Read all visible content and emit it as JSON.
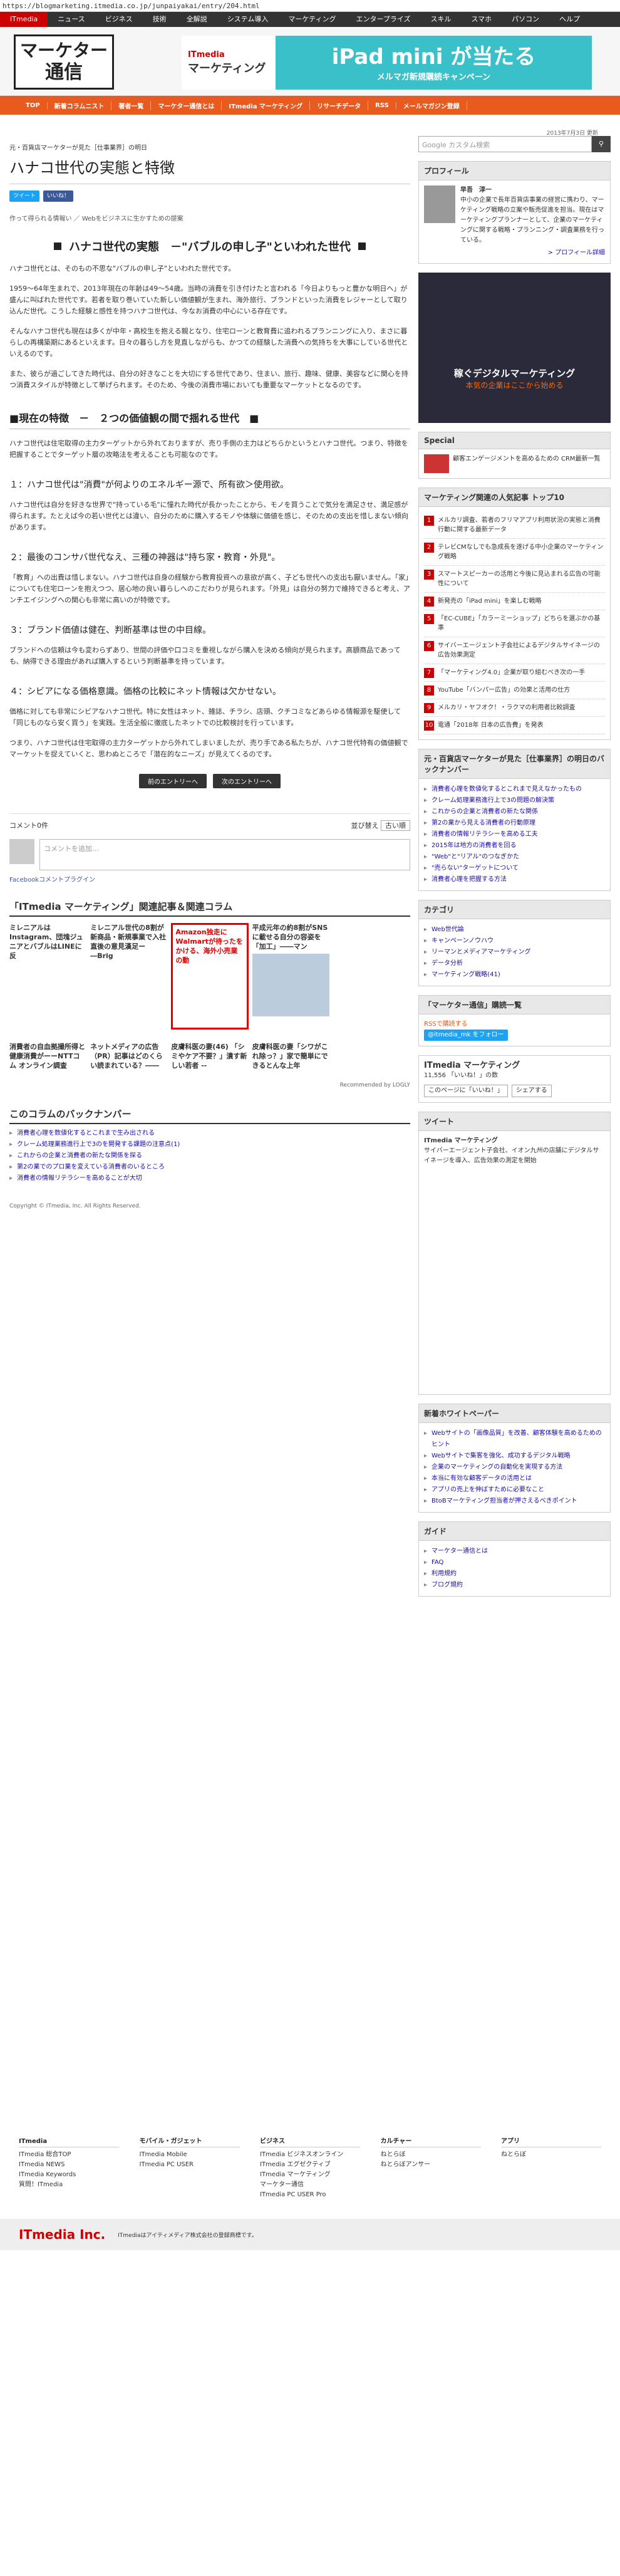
{
  "url": "https://blogmarketing.itmedia.co.jp/junpaiyakai/entry/204.html",
  "global_nav": [
    "ITmedia",
    "ニュース",
    "ビジネス",
    "技術",
    "全解説",
    "システム導入",
    "マーケティング",
    "エンタープライズ",
    "スキル",
    "スマホ",
    "パソコン",
    "ヘルプ"
  ],
  "logo": {
    "line1": "マーケター",
    "line2": "通信"
  },
  "banner": {
    "brand1": "ITmedia",
    "brand2": "マーケティング",
    "headline": "iPad mini が当たる",
    "sub": "メルマガ新規購読キャンペーン"
  },
  "red_nav": [
    "TOP",
    "新着コラムニスト",
    "著者一覧",
    "マーケター通信とは",
    "ITmedia マーケティング",
    "リサーチデータ",
    "RSS",
    "メールマガジン登録"
  ],
  "article": {
    "breadcrumb": "元・百貨店マーケターが見た［仕事業界］の明日",
    "date": "2013年7月3日 更新",
    "title": "ハナコ世代の実態と特徴",
    "tweet": "ツイート",
    "like": "いいね！",
    "related_line": "作って得られる情報い ／ Webをビジネスに生かすための提案",
    "section1": "ハナコ世代の実態　－\"バブルの申し子\"といわれた世代",
    "p1": "ハナコ世代とは、そのもの不思な\"バブルの申し子\"といわれた世代です。",
    "p2": "1959〜64年生まれで、2013年現在の年齢は49〜54歳。当時の消費を引き付けたと言われる「今日よりもっと豊かな明日へ」が盛んに叫ばれた世代です。若者を取り巻いていた新しい価値観が生まれ、海外旅行、ブランドといった消費をレジャーとして取り込んだ世代。こうした経験と感性を持つハナコ世代は、今なお消費の中心にいる存在です。",
    "p3": "そんなハナコ世代も現在は多くが中年・高校生を抱える親となり、住宅ローンと教育費に追われるプランニングに入り、まさに暮らしの再構築期にあるといえます。日々の暮らし方を見直しながらも、かつての経験した消費への気持ちを大事にしている世代といえるのです。",
    "p4": "また、彼らが過ごしてきた時代は、自分の好きなことを大切にする世代であり、住まい、旅行、趣味、健康、美容などに関心を持つ消費スタイルが特徴として挙げられます。そのため、今後の消費市場においても重要なマーケットとなるのです。",
    "section2": "■現在の特徴　－　２つの価値観の間で揺れる世代　■",
    "p5": "ハナコ世代は住宅取得の主力ターゲットから外れておりますが、売り手側の主力はどちらかというとハナコ世代。つまり、特徴を把握することでターゲット層の攻略法を考えることも可能なのです。",
    "h3a": "１：ハナコ世代は\"消費\"が何よりのエネルギー源で、所有欲＞使用欲。",
    "p6": "ハナコ世代は自分を好きな世界で\"持っている毛\"に憧れた時代が長かったことから、モノを買うことで気分を満足させ、満足感が得られます。たとえば今の若い世代とは違い、自分のために購入するモノや体験に価値を感じ、そのための支出を惜しまない傾向があります。",
    "h3b": "２：最後のコンサバ世代なえ、三種の神器は\"持ち家・教育・外見\"。",
    "p7": "「教育」への出費は惜しまない。ハナコ世代は自身の経験から教育投資への意欲が高く、子ども世代への支出も厭いません。「家」についても住宅ローンを抱えつつ、居心地の良い暮らしへのこだわりが見られます。「外見」は自分の努力で維持できると考え、アンチエイジングへの関心も非常に高いのが特徴です。",
    "h3c": "３：ブランド価値は健在、判断基準は世の中目線。",
    "p8": "ブランドへの信頼は今も変わらずあり、世間の評価や口コミを重視しながら購入を決める傾向が見られます。高額商品であっても、納得できる理由があれば購入するという判断基準を持っています。",
    "h3d": "４：シビアになる価格意識。価格の比較にネット情報は欠かせない。",
    "p9": "価格に対しても非常にシビアなハナコ世代。特に女性はネット、雑誌、チラシ、店頭、クチコミなどあらゆる情報源を駆使して「同じものなら安く買う」を実践。生活全般に徹底したネットでの比較検討を行っています。",
    "p10": "つまり、ハナコ世代は住宅取得の主力ターゲットから外れてしまいましたが、売り手である私たちが、ハナコ世代特有の価値観でマーケットを捉えていくと、思わぬところで「潜在的なニーズ」が見えてくるのです。",
    "prev": "前のエントリーへ",
    "next": "次のエントリーへ"
  },
  "comments": {
    "count": "コメント0件",
    "sort": "並び替え",
    "sort_val": "古い順",
    "placeholder": "コメントを追加...",
    "fb": "Facebookコメントプラグイン"
  },
  "related": {
    "header": "「ITmedia マーケティング」関連記事＆関連コラム",
    "row1": [
      "ミレニアルはInstagram、団塊ジュニアとバブルはLINEに反",
      "ミレニアル世代の8割が新商品・新規事業で入社直後の意見漢足ー―Brig",
      "Amazon独走にWalmartが待ったをかける、海外小売業の動",
      "平成元年の約8割がSNSに載せる自分の容姿を「加工」――マン",
      ""
    ],
    "row2": [
      "消費者の自血拠撮所得と健康消費がーーNTTコム オンライン調査",
      "ネットメディアの広告（PR）記事はどのくらい読まれている？――",
      "皮膚科医の妻(46) 「シミやケア不要？」潰す新しい若者 --",
      "皮膚科医の妻「シワがこれ除っ？」家で簡単にできるとんな上年",
      ""
    ],
    "recommended": "Recommended by LOGLY"
  },
  "backnumber": {
    "header": "このコラムのバックナンバー",
    "items": [
      "消費者心理を数値化するとこれまで生み出される",
      "クレーム処理業務進行上で3のを開発する課題の注意点(1)",
      "これからの企業と消費者の新たな関係を探る",
      "第2の業でのプロ業を変えている消費者のいるところ",
      "消費者の情報リテラシーを高めることが大切"
    ]
  },
  "copyright": "Copyright © ITmedia, Inc. All Rights Reserved.",
  "sidebar": {
    "search_placeholder": "Google カスタム検索",
    "profile_title": "プロフィール",
    "profile_name": "早吾　淳一",
    "profile_text": "中小の企業で長年百貨店事業の経営に携わり、マーケティング戦略の立案や販売促進を担当。現在はマーケティングプランナーとして、企業のマーケティングに関する戦略・プランニング・調査業務を行っている。",
    "profile_link": "> プロフィール詳細",
    "ad_title1": "稼ぐデジタルマーケティング",
    "ad_title2": "本気の企業はここから始める",
    "special": "Special",
    "special_text": "顧客エンゲージメントを高めるための CRM最新一覧",
    "ranking_title": "マーケティング関連の人気記事 トップ10",
    "ranking": [
      "メルカリ調査、若者のフリマアプリ利用状況の実態と消費行動に関する最新データ",
      "テレビCMなしでも急成長を遂げる中小企業のマーケティング戦略",
      "スマートスピーカーの活用と今後に見込まれる広告の可能性について",
      "新発売の「iPad mini」を楽しむ戦略",
      "「EC-CUBE」「カラーミーショップ」どちらを選ぶかの基準",
      "サイバーエージェント子会社によるデジタルサイネージの広告効果測定",
      "「マーケティング4.0」企業が取り組むべき次の一手",
      "YouTube「バンパー広告」の効果と活用の仕方",
      "メルカリ・ヤフオク！・ラクマの利用者比較調査",
      "電通「2018年 日本の広告費」を発表"
    ],
    "column_title": "元・百貨店マーケターが見た［仕事業界］の明日のバックナンバー",
    "column_items": [
      "消費者心理を数値化するとこれまで見えなかったもの",
      "クレーム処理業務進行上で3の問題の解決策",
      "これからの企業と消費者の新たな関係",
      "第2の業から見える消費者の行動原理",
      "消費者の情報リテラシーを高める工夫",
      "2015年は地方の消費者を回る",
      "\"Web\"と\"リアル\"のつなぎかた",
      "\"売らない\"ターゲットについて",
      "消費者心理を把握する方法"
    ],
    "category_title": "カテゴリ",
    "categories": [
      "Web世代論",
      "キャンペーンノウハウ",
      "リーマンとメディアマーケティング",
      "データ分析",
      "マーケティング戦略(41)"
    ],
    "mk_title": "「マーケター通信」購読一覧",
    "rss": "RSSで購読する",
    "twitter": "@itmedia_mk をフォロー",
    "fb_name": "ITmedia マーケティング",
    "fb_likes": "11,556 「いいね！」の数",
    "fb_like": "このページに「いいね！」",
    "fb_share": "シェアする",
    "tweets_title": "ツイート",
    "tw_author": "ITmedia マーケティング",
    "tw_text": "サイバーエージェント子会社、イオン九州の店舗にデジタルサイネージを導入、広告効果の測定を開始",
    "news_title": "新着ホワイトペーパー",
    "news": [
      "Webサイトの「画像品質」を改善、顧客体験を高めるためのヒント",
      "Webサイトで集客を強化、成功するデジタル戦略",
      "企業のマーケティングの自動化を実現する方法",
      "本当に有効な顧客データの活用とは",
      "アプリの売上を伸ばすために必要なこと",
      "BtoBマーケティング担当者が押さえるべきポイント"
    ],
    "guide_title": "ガイド",
    "guide": [
      "マーケター通信とは",
      "FAQ",
      "利用規約",
      "ブログ規約"
    ]
  },
  "footer": {
    "cols": [
      {
        "head": "ITmedia",
        "items": [
          "ITmedia 総合TOP",
          "ITmedia NEWS",
          "ITmedia Keywords",
          "質問！ITmedia"
        ]
      },
      {
        "head": "モバイル・ガジェット",
        "items": [
          "ITmedia Mobile",
          "ITmedia PC USER"
        ]
      },
      {
        "head": "ビジネス",
        "items": [
          "ITmedia ビジネスオンライン",
          "ITmedia エグゼクティブ",
          "ITmedia マーケティング",
          "マーケター通信",
          "ITmedia PC USER Pro"
        ]
      },
      {
        "head": "カルチャー",
        "items": [
          "ねとらぼ",
          "ねとらぼアンサー"
        ]
      },
      {
        "head": "アプリ",
        "items": [
          "ねとらぼ"
        ]
      }
    ],
    "bottom_links": "ITmediaはアイティメディア株式会社の登録商標です。",
    "brand": "ITmedia Inc."
  }
}
